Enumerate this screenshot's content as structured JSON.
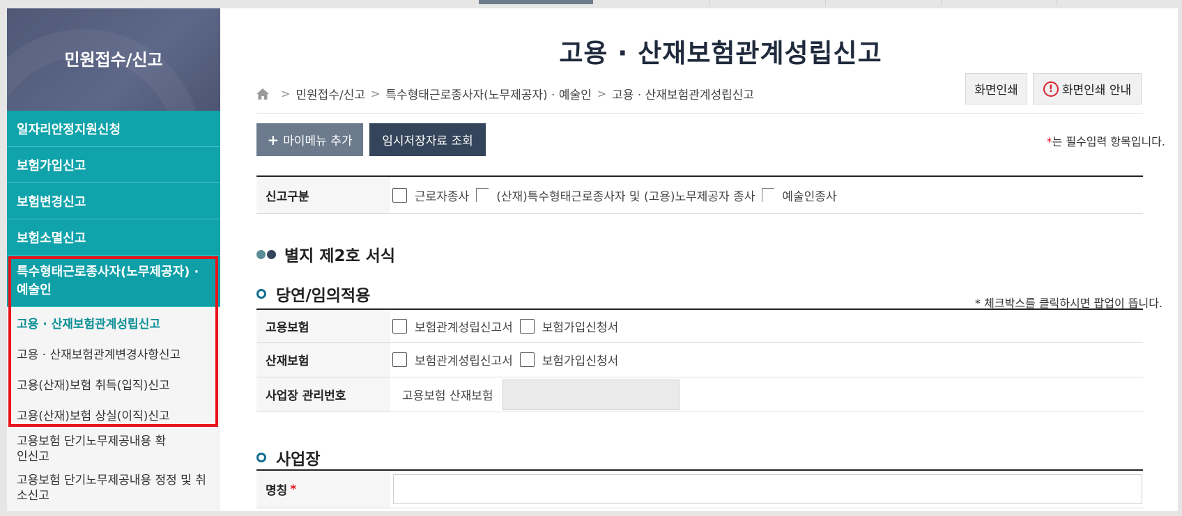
{
  "sidebar": {
    "title": "민원접수/신고",
    "menu": [
      {
        "label": "일자리안정지원신청"
      },
      {
        "label": "보험가입신고"
      },
      {
        "label": "보험변경신고"
      },
      {
        "label": "보험소멸신고"
      },
      {
        "label": "특수형태근로종사자(노무제공자) · 예술인"
      }
    ],
    "submenu": [
      {
        "label": "고용 · 산재보험관계성립신고"
      },
      {
        "label": "고용 · 산재보험관계변경사항신고"
      },
      {
        "label": "고용(산재)보험 취득(입직)신고"
      },
      {
        "label": "고용(산재)보험 상실(이직)신고"
      },
      {
        "label": "고용보험 단기노무제공내용 확인신고"
      },
      {
        "label": "고용보험 단기노무제공내용 정정 및 취소신고"
      }
    ]
  },
  "page": {
    "title": "고용 · 산재보험관계성립신고",
    "breadcrumb": [
      "민원접수/신고",
      "특수형태근로종사자(노무제공자) · 예술인",
      "고용 · 산재보험관계성립신고"
    ],
    "print_label": "화면인쇄",
    "print_guide_label": "화면인쇄 안내",
    "print_guide_icon_glyph": "!",
    "mymenu_label": "마이메뉴 추가",
    "temp_label": "임시저장자료 조회",
    "required_star": "*",
    "required_note": "는 필수입력 항목입니다."
  },
  "report_type": {
    "label": "신고구분",
    "options": [
      "근로자종사",
      "(산재)특수형태근로종사자 및 (고용)노무제공자 종사",
      "예술인종사"
    ]
  },
  "section_form": {
    "title": "별지 제2호 서식"
  },
  "section_auto": {
    "title": "당연/임의적용",
    "note": "* 체크박스를 클릭하시면 팝업이 뜹니다.",
    "employment": {
      "label": "고용보험",
      "options": [
        "보험관계성립신고서",
        "보험가입신청서"
      ]
    },
    "industrial": {
      "label": "산재보험",
      "options": [
        "보험관계성립신고서",
        "보험가입신청서"
      ]
    },
    "mgmt_no": {
      "label": "사업장 관리번호",
      "text": "고용보험 산재보험"
    }
  },
  "section_workplace": {
    "title": "사업장",
    "name_label": "명칭",
    "name_value": ""
  },
  "colors": {
    "teal": "#11a3ab",
    "navy": "#34445a",
    "highlight": "#e8141c"
  },
  "icons": [
    "home-icon",
    "plus-icon",
    "warning-icon"
  ]
}
